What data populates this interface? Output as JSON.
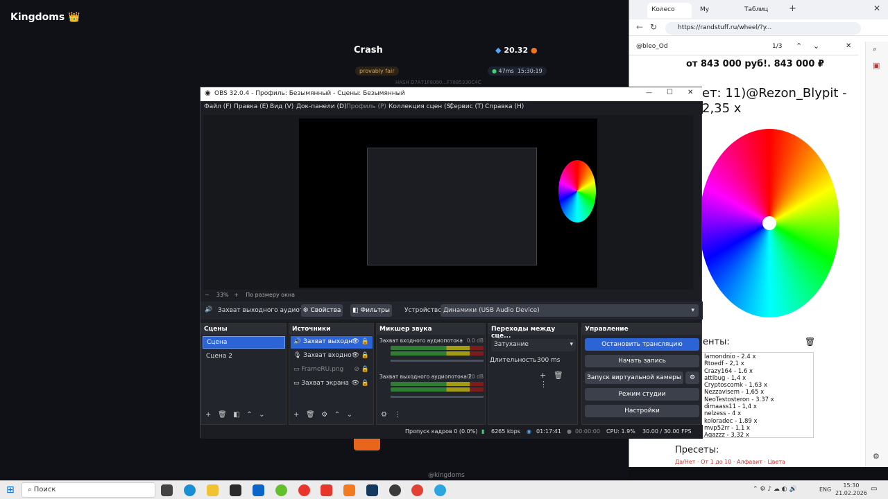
{
  "game": {
    "brand": "Kingdoms 👑",
    "crash_title": "Crash",
    "balance": "20.32",
    "provably_fair": "provably fair",
    "ping": "47ms",
    "time": "15:30:19",
    "hash": "HASH  D7A71F8090...F7885330C4C",
    "footer": "@kingdoms"
  },
  "browser": {
    "tabs": [
      "Колесо",
      "Му",
      "Таблиц"
    ],
    "url": "https://randstuff.ru/wheel/?y...",
    "find_query": "@bleo_Od",
    "find_count": "1/3",
    "price": "от 843 000 руб!. 843 000 ₽",
    "result": "ет: 11)@Rezon_Blypit - 2,35 x",
    "participants_label": "енты:",
    "participants": [
      "lamondnio - 2.4 x",
      "Rtoedf - 2,1 x",
      "Crazy164 - 1.6 x",
      "attibug - 1,4 x",
      "Cryptoscomk - 1,63 x",
      "Nezzavisem - 1,65 x",
      "NeoTestosteron - 3.37 x",
      "dimaass11 - 1,4 x",
      "nelzess - 4 x",
      "koloradec - 1.89 x",
      "mvp52rr - 1,1 x",
      "Agazzz - 3,32 x"
    ],
    "presets_label": "Пресеты:",
    "presets_sub": "Да/Нет · От 1 до 10 · Алфавит · Цвета"
  },
  "obs": {
    "title": "OBS 32.0.4 - Профиль: Безымянный - Сцены: Безымянный",
    "menu": [
      "Файл (F)",
      "Правка (E)",
      "Вид (V)",
      "Док-панели (D)",
      "Профиль (P)",
      "Коллекция сцен (S)",
      "Сервис (T)",
      "Справка (H)"
    ],
    "zoom": "33%",
    "zoom_mode": "По размеру окна",
    "source_name": "Захват выходного аудиот",
    "properties": "Свойства",
    "filters": "Фильтры",
    "device_label": "Устройство",
    "device_value": "Динамики (USB Audio Device)",
    "scenes_title": "Сцены",
    "scenes": [
      "Сцена",
      "Сцена 2"
    ],
    "sources_title": "Источники",
    "sources": [
      "Захват выходн",
      "Захват входно",
      "FrameRU.png",
      "Захват экрана"
    ],
    "mixer_title": "Микшер звука",
    "mixer": [
      {
        "name": "Захват входного аудиопотока",
        "db": "0.0 dB"
      },
      {
        "name": "Захват выходного аудиопотока 2",
        "db": "0.0 dB"
      }
    ],
    "meter_ticks": [
      "-60",
      "-55",
      "-50",
      "-45",
      "-40",
      "-35",
      "-30",
      "-25",
      "-20",
      "-15",
      "-10",
      "-5",
      "0"
    ],
    "transitions_title": "Переходы между сце...",
    "transition": "Затухание",
    "duration_label": "Длительность",
    "duration_value": "300 ms",
    "controls_title": "Управление",
    "controls": [
      "Остановить трансляцию",
      "Начать запись",
      "Запуск виртуальной камеры",
      "Режим студии",
      "Настройки"
    ],
    "status": {
      "dropped": "Пропуск кадров 0 (0.0%)",
      "bitrate": "6265 kbps",
      "stream_time": "01:17:41",
      "rec_time": "00:00:00",
      "cpu": "CPU: 1.9%",
      "fps": "30.00 / 30.00 FPS"
    }
  },
  "taskbar": {
    "search": "Поиск",
    "lang": "ENG",
    "time": "15:30",
    "date": "21.02.2026"
  },
  "colors": {
    "obs_accent": "#2c64d6",
    "game_bg": "#101116",
    "obs_bg": "#1b1d22"
  }
}
